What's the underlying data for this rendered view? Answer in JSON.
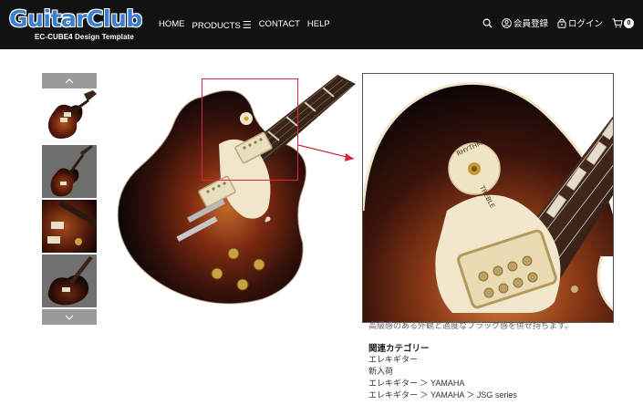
{
  "header": {
    "logo_main": "GuitarClub",
    "logo_sub": "EC-CUBE4 Design Template",
    "nav": [
      {
        "label": "HOME"
      },
      {
        "label": "PRODUCTS"
      },
      {
        "label": "CONTACT"
      },
      {
        "label": "HELP"
      }
    ],
    "member_label": "会員登録",
    "login_label": "ログイン",
    "cart_count": "0",
    "icons": [
      "search-icon",
      "user-icon",
      "lock-icon",
      "cart-icon",
      "menu-icon"
    ]
  },
  "gallery": {
    "thumb_count": 4,
    "selected_index": 0
  },
  "description": {
    "partial_text": "高級感のある外観と適度なプラック感を併せ持ちます。",
    "related_title": "関連カテゴリー",
    "related": [
      "エレキギター",
      "新入荷",
      "エレキギター ＞ YAMAHA",
      "エレキギター ＞ YAMAHA ＞ JSG series"
    ]
  },
  "colors": {
    "header_bg": "#121212",
    "logo_blue": "#3a7fd0",
    "lens_red": "#d7263d",
    "arrow_gray": "#9a9a9a"
  }
}
